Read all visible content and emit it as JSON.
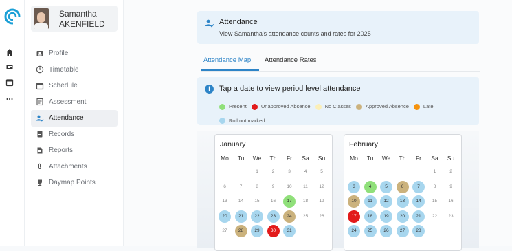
{
  "student": {
    "first": "Samantha",
    "last": "AKENFIELD"
  },
  "nav": [
    {
      "label": "Profile",
      "icon": "profile-icon"
    },
    {
      "label": "Timetable",
      "icon": "clock-icon"
    },
    {
      "label": "Schedule",
      "icon": "calendar-icon"
    },
    {
      "label": "Assessment",
      "icon": "assessment-icon"
    },
    {
      "label": "Attendance",
      "icon": "attendance-icon",
      "active": true
    },
    {
      "label": "Records",
      "icon": "records-icon"
    },
    {
      "label": "Reports",
      "icon": "reports-icon"
    },
    {
      "label": "Attachments",
      "icon": "attachment-icon"
    },
    {
      "label": "Daymap Points",
      "icon": "trophy-icon"
    }
  ],
  "header": {
    "title": "Attendance",
    "subtitle": "View Samantha's attendance counts and rates for 2025"
  },
  "tabs": {
    "map": "Attendance Map",
    "rates": "Attendance Rates"
  },
  "info": {
    "title": "Tap a date to view period level attendance"
  },
  "legend": [
    {
      "label": "Present",
      "color": "#90e07a"
    },
    {
      "label": "Unapproved Absence",
      "color": "#e21b1b"
    },
    {
      "label": "No Classes",
      "color": "#fbefb8"
    },
    {
      "label": "Approved Absence",
      "color": "#cbb27d"
    },
    {
      "label": "Late",
      "color": "#f5930e"
    },
    {
      "label": "Roll not marked",
      "color": "#a7d6ee"
    }
  ],
  "weekdays": [
    "Mo",
    "Tu",
    "We",
    "Th",
    "Fr",
    "Sa",
    "Su"
  ],
  "months": [
    {
      "name": "January",
      "days": [
        {
          "d": "1",
          "col": 2,
          "row": 0
        },
        {
          "d": "2",
          "col": 3,
          "row": 0
        },
        {
          "d": "3",
          "col": 4,
          "row": 0
        },
        {
          "d": "4",
          "col": 5,
          "row": 0
        },
        {
          "d": "5",
          "col": 6,
          "row": 0
        },
        {
          "d": "6",
          "col": 0,
          "row": 1
        },
        {
          "d": "7",
          "col": 1,
          "row": 1
        },
        {
          "d": "8",
          "col": 2,
          "row": 1
        },
        {
          "d": "9",
          "col": 3,
          "row": 1
        },
        {
          "d": "10",
          "col": 4,
          "row": 1
        },
        {
          "d": "11",
          "col": 5,
          "row": 1
        },
        {
          "d": "12",
          "col": 6,
          "row": 1
        },
        {
          "d": "13",
          "col": 0,
          "row": 2
        },
        {
          "d": "14",
          "col": 1,
          "row": 2
        },
        {
          "d": "15",
          "col": 2,
          "row": 2
        },
        {
          "d": "16",
          "col": 3,
          "row": 2
        },
        {
          "d": "17",
          "col": 4,
          "row": 2,
          "status": "present"
        },
        {
          "d": "18",
          "col": 5,
          "row": 2
        },
        {
          "d": "19",
          "col": 6,
          "row": 2
        },
        {
          "d": "20",
          "col": 0,
          "row": 3,
          "status": "roll"
        },
        {
          "d": "21",
          "col": 1,
          "row": 3,
          "status": "roll"
        },
        {
          "d": "22",
          "col": 2,
          "row": 3,
          "status": "roll"
        },
        {
          "d": "23",
          "col": 3,
          "row": 3,
          "status": "roll"
        },
        {
          "d": "24",
          "col": 4,
          "row": 3,
          "status": "approved"
        },
        {
          "d": "25",
          "col": 5,
          "row": 3
        },
        {
          "d": "26",
          "col": 6,
          "row": 3
        },
        {
          "d": "27",
          "col": 0,
          "row": 4
        },
        {
          "d": "28",
          "col": 1,
          "row": 4,
          "status": "approved"
        },
        {
          "d": "29",
          "col": 2,
          "row": 4,
          "status": "roll"
        },
        {
          "d": "30",
          "col": 3,
          "row": 4,
          "status": "unapproved"
        },
        {
          "d": "31",
          "col": 4,
          "row": 4,
          "status": "roll"
        }
      ]
    },
    {
      "name": "February",
      "days": [
        {
          "d": "1",
          "col": 5,
          "row": 0
        },
        {
          "d": "2",
          "col": 6,
          "row": 0
        },
        {
          "d": "3",
          "col": 0,
          "row": 1,
          "status": "roll"
        },
        {
          "d": "4",
          "col": 1,
          "row": 1,
          "status": "present"
        },
        {
          "d": "5",
          "col": 2,
          "row": 1,
          "status": "roll"
        },
        {
          "d": "6",
          "col": 3,
          "row": 1,
          "status": "approved"
        },
        {
          "d": "7",
          "col": 4,
          "row": 1,
          "status": "roll"
        },
        {
          "d": "8",
          "col": 5,
          "row": 1
        },
        {
          "d": "9",
          "col": 6,
          "row": 1
        },
        {
          "d": "10",
          "col": 0,
          "row": 2,
          "status": "approved"
        },
        {
          "d": "11",
          "col": 1,
          "row": 2,
          "status": "roll"
        },
        {
          "d": "12",
          "col": 2,
          "row": 2,
          "status": "roll"
        },
        {
          "d": "13",
          "col": 3,
          "row": 2,
          "status": "roll"
        },
        {
          "d": "14",
          "col": 4,
          "row": 2,
          "status": "roll"
        },
        {
          "d": "15",
          "col": 5,
          "row": 2
        },
        {
          "d": "16",
          "col": 6,
          "row": 2
        },
        {
          "d": "17",
          "col": 0,
          "row": 3,
          "status": "unapproved"
        },
        {
          "d": "18",
          "col": 1,
          "row": 3,
          "status": "roll"
        },
        {
          "d": "19",
          "col": 2,
          "row": 3,
          "status": "roll"
        },
        {
          "d": "20",
          "col": 3,
          "row": 3,
          "status": "roll"
        },
        {
          "d": "21",
          "col": 4,
          "row": 3,
          "status": "roll"
        },
        {
          "d": "22",
          "col": 5,
          "row": 3
        },
        {
          "d": "23",
          "col": 6,
          "row": 3
        },
        {
          "d": "24",
          "col": 0,
          "row": 4,
          "status": "roll"
        },
        {
          "d": "25",
          "col": 1,
          "row": 4,
          "status": "roll"
        },
        {
          "d": "26",
          "col": 2,
          "row": 4,
          "status": "roll"
        },
        {
          "d": "27",
          "col": 3,
          "row": 4,
          "status": "roll"
        },
        {
          "d": "28",
          "col": 4,
          "row": 4,
          "status": "roll"
        }
      ]
    }
  ],
  "status_colors": {
    "present": "#90e07a",
    "unapproved": "#e21b1b",
    "approved": "#cbb27d",
    "roll": "#a7d6ee"
  }
}
